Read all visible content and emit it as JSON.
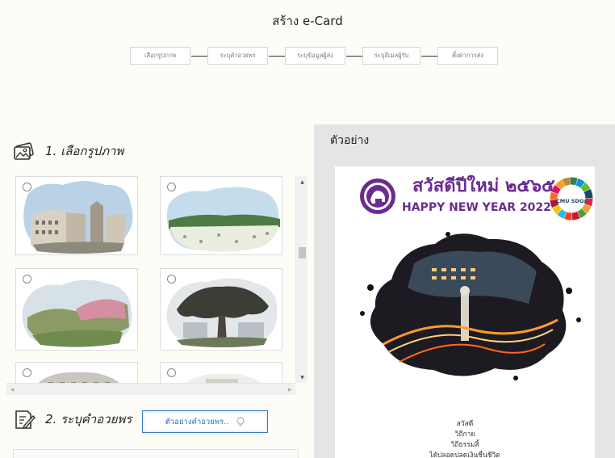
{
  "page_title": "สร้าง e-Card",
  "steps": [
    {
      "label": "เลือกรูปภาพ"
    },
    {
      "label": "ระบุคำอวยพร"
    },
    {
      "label": "ระบุข้อมูลผู้ส่ง"
    },
    {
      "label": "ระบุอีเมลผู้รับ"
    },
    {
      "label": "ตั้งค่าการส่ง"
    }
  ],
  "section1": {
    "title": "1. เลือกรูปภาพ",
    "icon": "image-gallery-icon"
  },
  "section2": {
    "title": "2. ระบุคำอวยพร",
    "icon": "edit-note-icon",
    "example_button": "ตัวอย่างคำอวยพร..",
    "example_button_icon": "lightbulb-icon"
  },
  "gallery": {
    "images": [
      {
        "subject": "campus-buildings"
      },
      {
        "subject": "flower-field-mountains"
      },
      {
        "subject": "hillside-pink-trees"
      },
      {
        "subject": "big-rain-tree"
      },
      {
        "subject": "building-facade"
      },
      {
        "subject": "building-sign"
      }
    ],
    "selected_index": null
  },
  "preview": {
    "title": "ตัวอย่าง",
    "card": {
      "greeting_th": "สวัสดีปีใหม่ ๒๕๖๕",
      "greeting_en": "HAPPY NEW YEAR 2022",
      "badge": "CMU SDGs",
      "message_lines": [
        "สวัสดี",
        "วิถีกาย",
        "วิถีธรรมสิ้",
        "ได้ปลอดปลดเงินชื่นชีวิต"
      ]
    }
  },
  "colors": {
    "accent_purple": "#6a2c91",
    "button_blue": "#3a7bc4",
    "panel_gray": "#e5e5e5",
    "page_bg": "#fdfcf7"
  }
}
